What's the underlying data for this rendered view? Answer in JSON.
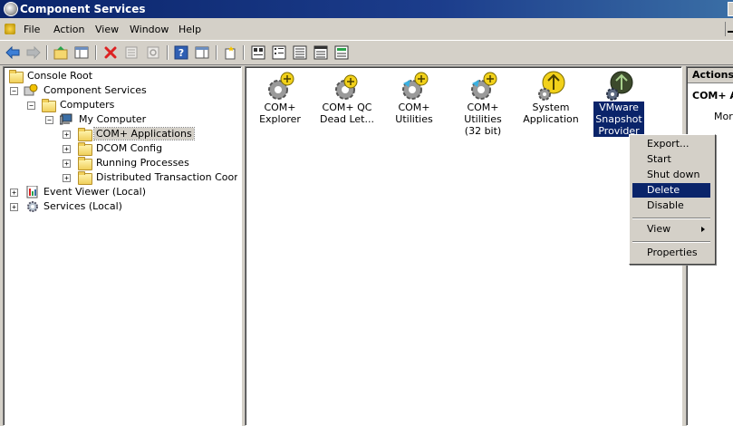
{
  "window": {
    "title": "Component Services"
  },
  "menus": [
    "File",
    "Action",
    "View",
    "Window",
    "Help"
  ],
  "tree": {
    "console_root": "Console Root",
    "component_services": "Component Services",
    "computers": "Computers",
    "my_computer": "My Computer",
    "com_apps": "COM+ Applications",
    "dcom_config": "DCOM Config",
    "running_processes": "Running Processes",
    "dtc": "Distributed Transaction Coordinat",
    "event_viewer": "Event Viewer (Local)",
    "services": "Services (Local)"
  },
  "apps": [
    {
      "line1": "COM+",
      "line2": "Explorer",
      "line3": ""
    },
    {
      "line1": "COM+ QC",
      "line2": "Dead Let...",
      "line3": ""
    },
    {
      "line1": "COM+ Utilities",
      "line2": "",
      "line3": ""
    },
    {
      "line1": "COM+ Utilities",
      "line2": "(32 bit)",
      "line3": ""
    },
    {
      "line1": "System",
      "line2": "Application",
      "line3": ""
    },
    {
      "line1": "VMware",
      "line2": "Snapshot",
      "line3": "Provider"
    }
  ],
  "actions": {
    "header": "Actions",
    "subheader": "COM+ A",
    "more": "More"
  },
  "context_menu": {
    "export": "Export...",
    "start": "Start",
    "shutdown": "Shut down",
    "delete": "Delete",
    "disable": "Disable",
    "view": "View",
    "properties": "Properties"
  },
  "colors": {
    "titlebar": "#0a246a",
    "selection": "#0a246a",
    "chrome": "#d4d0c8",
    "pane": "#ffffff"
  },
  "icons": {
    "back": "back-arrow-icon",
    "forward": "forward-arrow-icon",
    "up": "up-folder-icon",
    "show_tree": "show-hide-tree-icon",
    "delete": "delete-x-icon",
    "properties": "properties-icon",
    "refresh": "refresh-icon",
    "help": "help-icon",
    "new_window": "new-window-icon",
    "new_item": "new-item-icon",
    "large_icons": "large-icons-view-icon",
    "small_icons": "small-icons-view-icon",
    "list": "list-view-icon",
    "detail": "detail-view-icon",
    "configure": "configure-icon"
  }
}
